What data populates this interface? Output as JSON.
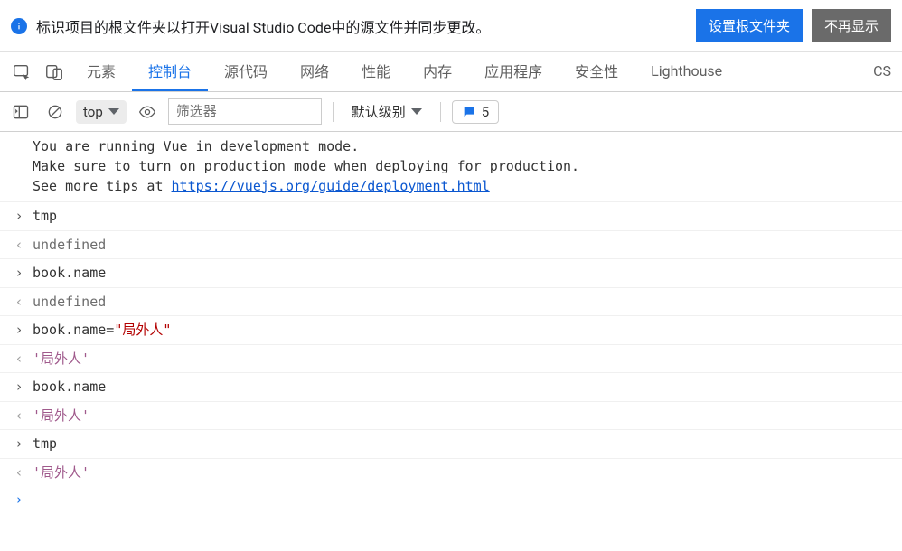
{
  "infobar": {
    "text": "标识项目的根文件夹以打开Visual Studio Code中的源文件并同步更改。",
    "set_root": "设置根文件夹",
    "dismiss": "不再显示"
  },
  "tabs": {
    "elements": "元素",
    "console": "控制台",
    "sources": "源代码",
    "network": "网络",
    "performance": "性能",
    "memory": "内存",
    "application": "应用程序",
    "security": "安全性",
    "lighthouse": "Lighthouse",
    "css_overflow": "CS"
  },
  "toolbar": {
    "context": "top",
    "filter_placeholder": "筛选器",
    "levels": "默认级别",
    "issues_count": "5"
  },
  "console_message": {
    "line1": "You are running Vue in development mode.",
    "line2": "Make sure to turn on production mode when deploying for production.",
    "line3_prefix": "See more tips at ",
    "line3_link": "https://vuejs.org/guide/deployment.html"
  },
  "entries": [
    {
      "dir": "in",
      "kind": "code",
      "text": "tmp"
    },
    {
      "dir": "out",
      "kind": "undef",
      "text": "undefined"
    },
    {
      "dir": "in",
      "kind": "code",
      "text": "book.name"
    },
    {
      "dir": "out",
      "kind": "undef",
      "text": "undefined"
    },
    {
      "dir": "in",
      "kind": "assign",
      "prefix": "book.name=",
      "value": "\"局外人\""
    },
    {
      "dir": "out",
      "kind": "str",
      "text": "'局外人'"
    },
    {
      "dir": "in",
      "kind": "code",
      "text": "book.name"
    },
    {
      "dir": "out",
      "kind": "str",
      "text": "'局外人'"
    },
    {
      "dir": "in",
      "kind": "code",
      "text": "tmp"
    },
    {
      "dir": "out",
      "kind": "str",
      "text": "'局外人'"
    }
  ]
}
